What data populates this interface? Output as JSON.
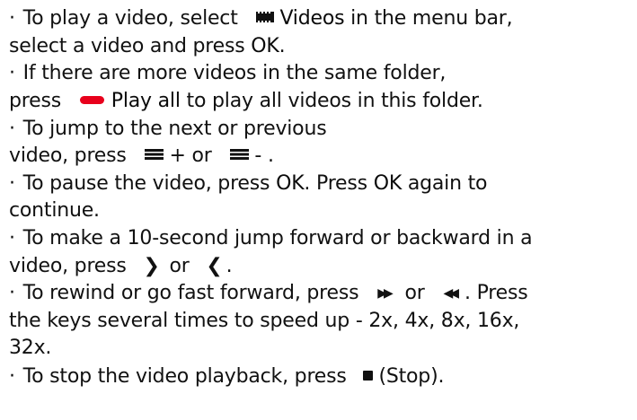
{
  "lines": {
    "l1": {
      "bullet": "·",
      "a": " To play a video, select ",
      "icon": "video-icon",
      "key": "Videos",
      "b": "  in the menu bar,"
    },
    "l2": {
      "a": "select a video and press ",
      "key": "OK",
      "b": "."
    },
    "l3": {
      "bullet": "·",
      "a": " If there are more videos in the same folder,"
    },
    "l4": {
      "a": "press ",
      "icon": "red-color-key-icon",
      "key": "Play all",
      "b": "  to play all videos in this folder."
    },
    "l5": {
      "bullet": "·",
      "a": " To jump to the next or previous"
    },
    "l6": {
      "a": "video, press ",
      "icon": "list-icon",
      "b": "+  or ",
      "c": "- ."
    },
    "l7": {
      "bullet": "·",
      "a": " To pause the video, press ",
      "key1": "OK",
      "b": ". Press ",
      "key2": "OK",
      "c": " again to"
    },
    "l8": {
      "a": "continue."
    },
    "l9": {
      "bullet": "·",
      "a": " To make a 10-second jump forward or backward in a"
    },
    "l10": {
      "a": "video, press ",
      "right": "❯",
      "b": " or ",
      "left": "❮",
      "c": "."
    },
    "l11": {
      "bullet": "·",
      "a": " To rewind or go fast forward, press ",
      "ff": "▶▶",
      "b": " or ",
      "rw": "◀◀",
      "c": ". Press"
    },
    "l12": {
      "a": "the keys several times to speed up - 2x, 4x, 8x, 16x,"
    },
    "l13": {
      "a": "32x."
    },
    "l14": {
      "bullet": "·",
      "a": " To stop the video playback, press ",
      "icon": "stop-icon",
      "b": "(Stop)."
    }
  },
  "colors": {
    "text": "#111111",
    "red_key": "#e8001c"
  }
}
